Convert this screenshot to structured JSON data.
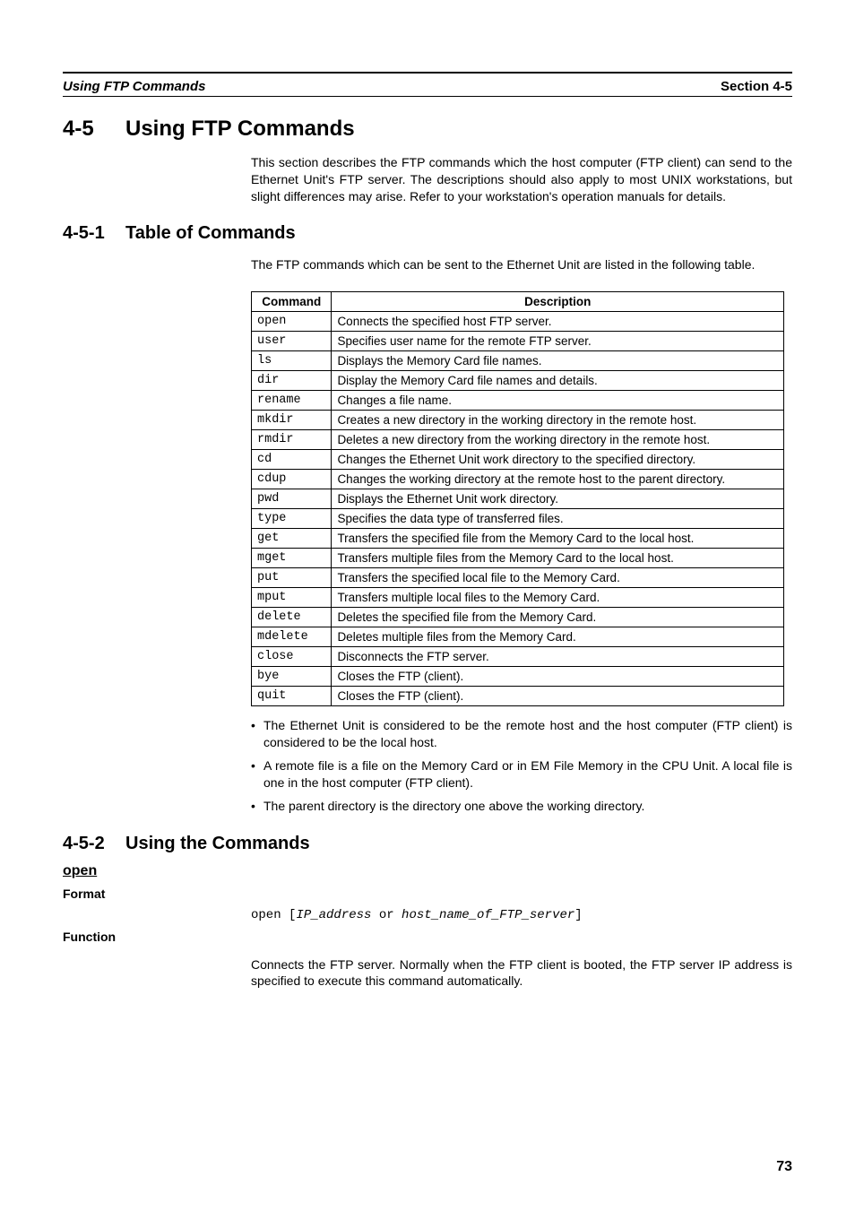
{
  "runningHead": {
    "left": "Using FTP Commands",
    "right": "Section 4-5"
  },
  "section": {
    "num": "4-5",
    "title": "Using FTP Commands",
    "intro": "This section describes the FTP commands which the host computer (FTP client) can send to the Ethernet Unit's FTP server. The descriptions should also apply to most UNIX workstations, but slight differences may arise. Refer to your workstation's operation manuals for details."
  },
  "sub1": {
    "num": "4-5-1",
    "title": "Table of Commands",
    "intro": "The FTP commands which can be sent to the Ethernet Unit are listed in the following table.",
    "headers": {
      "c1": "Command",
      "c2": "Description"
    },
    "rows": [
      {
        "cmd": "open",
        "desc": "Connects the specified host FTP server."
      },
      {
        "cmd": "user",
        "desc": "Specifies user name for the remote FTP server."
      },
      {
        "cmd": "ls",
        "desc": "Displays the Memory Card file names."
      },
      {
        "cmd": "dir",
        "desc": "Display the Memory Card file names and details."
      },
      {
        "cmd": "rename",
        "desc": "Changes a file name."
      },
      {
        "cmd": "mkdir",
        "desc": "Creates a new directory in the working directory in the remote host."
      },
      {
        "cmd": "rmdir",
        "desc": "Deletes a new directory from the working directory in the remote host."
      },
      {
        "cmd": "cd",
        "desc": "Changes the Ethernet Unit work directory to the specified directory."
      },
      {
        "cmd": "cdup",
        "desc": "Changes the working directory at the remote host to the parent directory."
      },
      {
        "cmd": "pwd",
        "desc": "Displays the Ethernet Unit work directory."
      },
      {
        "cmd": "type",
        "desc": "Specifies the data type of transferred files."
      },
      {
        "cmd": "get",
        "desc": "Transfers the specified file from the Memory Card to the local host."
      },
      {
        "cmd": "mget",
        "desc": "Transfers multiple files from the Memory Card to the local host."
      },
      {
        "cmd": "put",
        "desc": "Transfers the specified local file to the Memory Card."
      },
      {
        "cmd": "mput",
        "desc": "Transfers multiple local files to the Memory Card."
      },
      {
        "cmd": "delete",
        "desc": "Deletes the specified file from the Memory Card."
      },
      {
        "cmd": "mdelete",
        "desc": "Deletes multiple files from the Memory Card."
      },
      {
        "cmd": "close",
        "desc": "Disconnects the FTP server."
      },
      {
        "cmd": "bye",
        "desc": "Closes the FTP (client)."
      },
      {
        "cmd": "quit",
        "desc": "Closes the FTP (client)."
      }
    ],
    "notes": [
      "The Ethernet Unit is considered to be the remote host and the host computer (FTP client) is considered to be the local host.",
      "A remote file is a file on the Memory Card or in EM File Memory in the CPU Unit. A local file is one in the host computer (FTP client).",
      "The parent directory is the directory one above the working directory."
    ]
  },
  "sub2": {
    "num": "4-5-2",
    "title": "Using the Commands",
    "open": {
      "name": "open",
      "formatLabel": "Format",
      "code_prefix": "open [",
      "code_arg1": "IP_address",
      "code_or": " or ",
      "code_arg2": "host_name_of_FTP_server",
      "code_suffix": "]",
      "functionLabel": "Function",
      "functionText": "Connects the FTP server. Normally when the FTP client is booted, the FTP server IP address is specified to execute this command automatically."
    }
  },
  "pageNumber": "73"
}
